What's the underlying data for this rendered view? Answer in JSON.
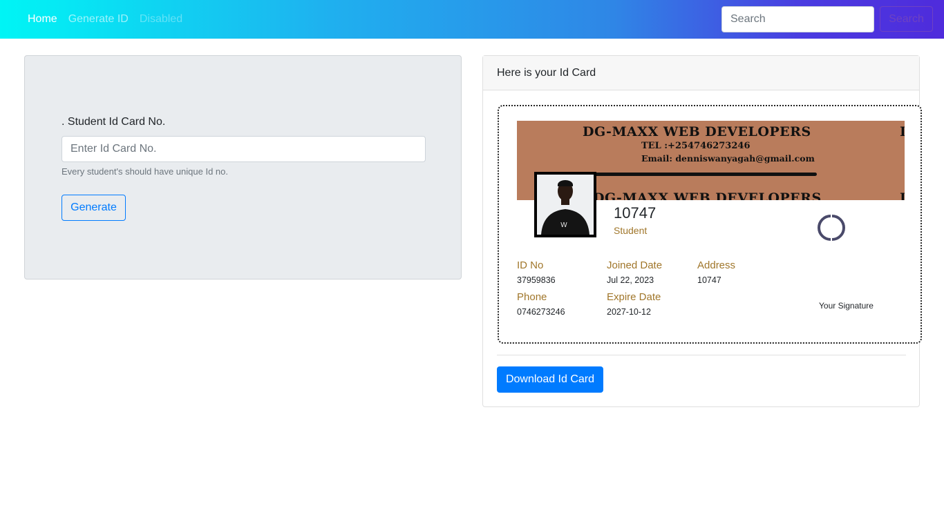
{
  "navbar": {
    "links": [
      {
        "label": "Home"
      },
      {
        "label": "Generate ID"
      },
      {
        "label": "Disabled"
      }
    ],
    "search_placeholder": "Search",
    "search_button": "Search"
  },
  "form": {
    "label": ". Student Id Card No.",
    "input_placeholder": "Enter Id Card No.",
    "input_value": "",
    "help_text": "Every student's should have unique Id no.",
    "generate_button": "Generate"
  },
  "card": {
    "header": "Here is your Id Card",
    "banner": {
      "title": "DG-MAXX WEB DEVELOPERS",
      "title_edge": "I",
      "tel": "TEL :+254746273246",
      "email": "Email: denniswanyagah@gmail.com"
    },
    "number": "10747",
    "role": "Student",
    "logo_icon": "chanel-logo-icon",
    "fields": {
      "id_no_label": "ID No",
      "id_no_value": "37959836",
      "joined_label": "Joined Date",
      "joined_value": "Jul 22, 2023",
      "address_label": "Address",
      "address_value": "10747",
      "phone_label": "Phone",
      "phone_value": "0746273246",
      "expire_label": "Expire Date",
      "expire_value": "2027-10-12"
    },
    "signature": "Your Signature",
    "download_button": "Download Id Card"
  },
  "colors": {
    "accent_blue": "#007bff",
    "label_gold": "#a0762a",
    "banner_brown": "#b97c5c",
    "nav_search_purple": "#6f42c1"
  }
}
